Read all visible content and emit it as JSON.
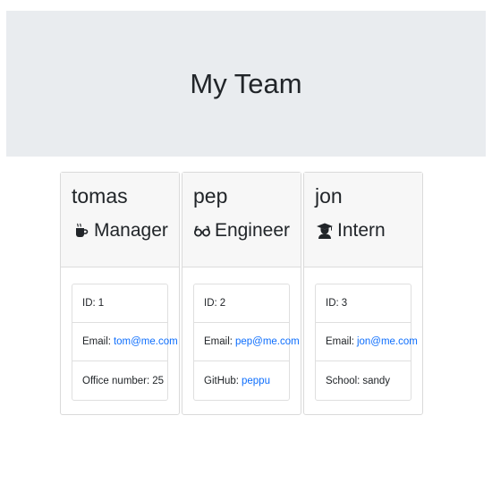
{
  "header": {
    "title": "My Team"
  },
  "members": [
    {
      "name": "tomas",
      "role": "Manager",
      "icon": "coffee-icon",
      "id_label": "ID:",
      "id": "1",
      "email_label": "Email:",
      "email": "tom@me.com",
      "extra_label": "Office number:",
      "extra": "25"
    },
    {
      "name": "pep",
      "role": "Engineer",
      "icon": "glasses-icon",
      "id_label": "ID:",
      "id": "2",
      "email_label": "Email:",
      "email": "pep@me.com",
      "extra_label": "GitHub:",
      "extra": "peppu"
    },
    {
      "name": "jon",
      "role": "Intern",
      "icon": "graduate-icon",
      "id_label": "ID:",
      "id": "3",
      "email_label": "Email:",
      "email": "jon@me.com",
      "extra_label": "School:",
      "extra": "sandy"
    }
  ],
  "colors": {
    "jumbotron": "#e9ecef",
    "link": "#0d6efd",
    "card_header": "#f7f7f7"
  }
}
